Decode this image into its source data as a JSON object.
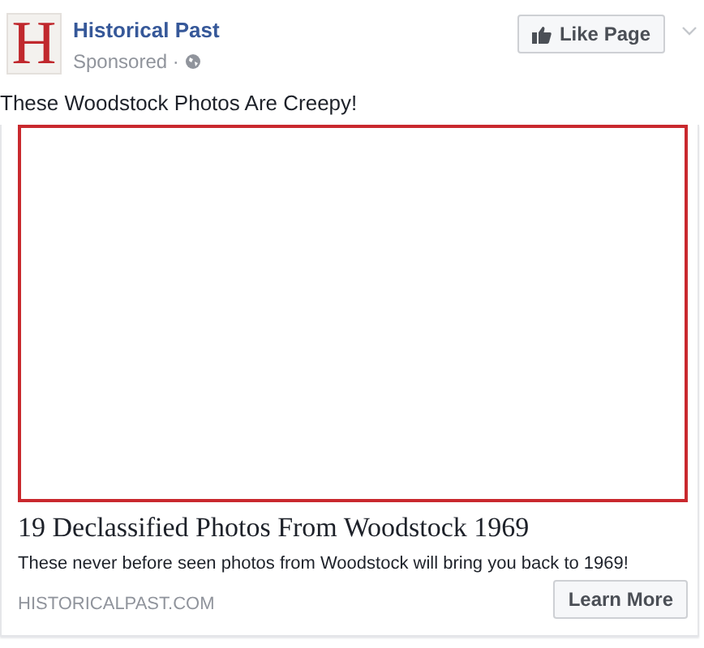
{
  "page": {
    "logo_letter": "H",
    "name": "Historical Past",
    "sponsored": "Sponsored · "
  },
  "like_button": "Like Page",
  "caption": "These Woodstock Photos Are Creepy!",
  "link": {
    "title": "19 Declassified Photos From Woodstock 1969",
    "description": "These never before seen photos from Woodstock will bring you back to 1969!",
    "domain": "HISTORICALPAST.COM",
    "button": "Learn More"
  }
}
